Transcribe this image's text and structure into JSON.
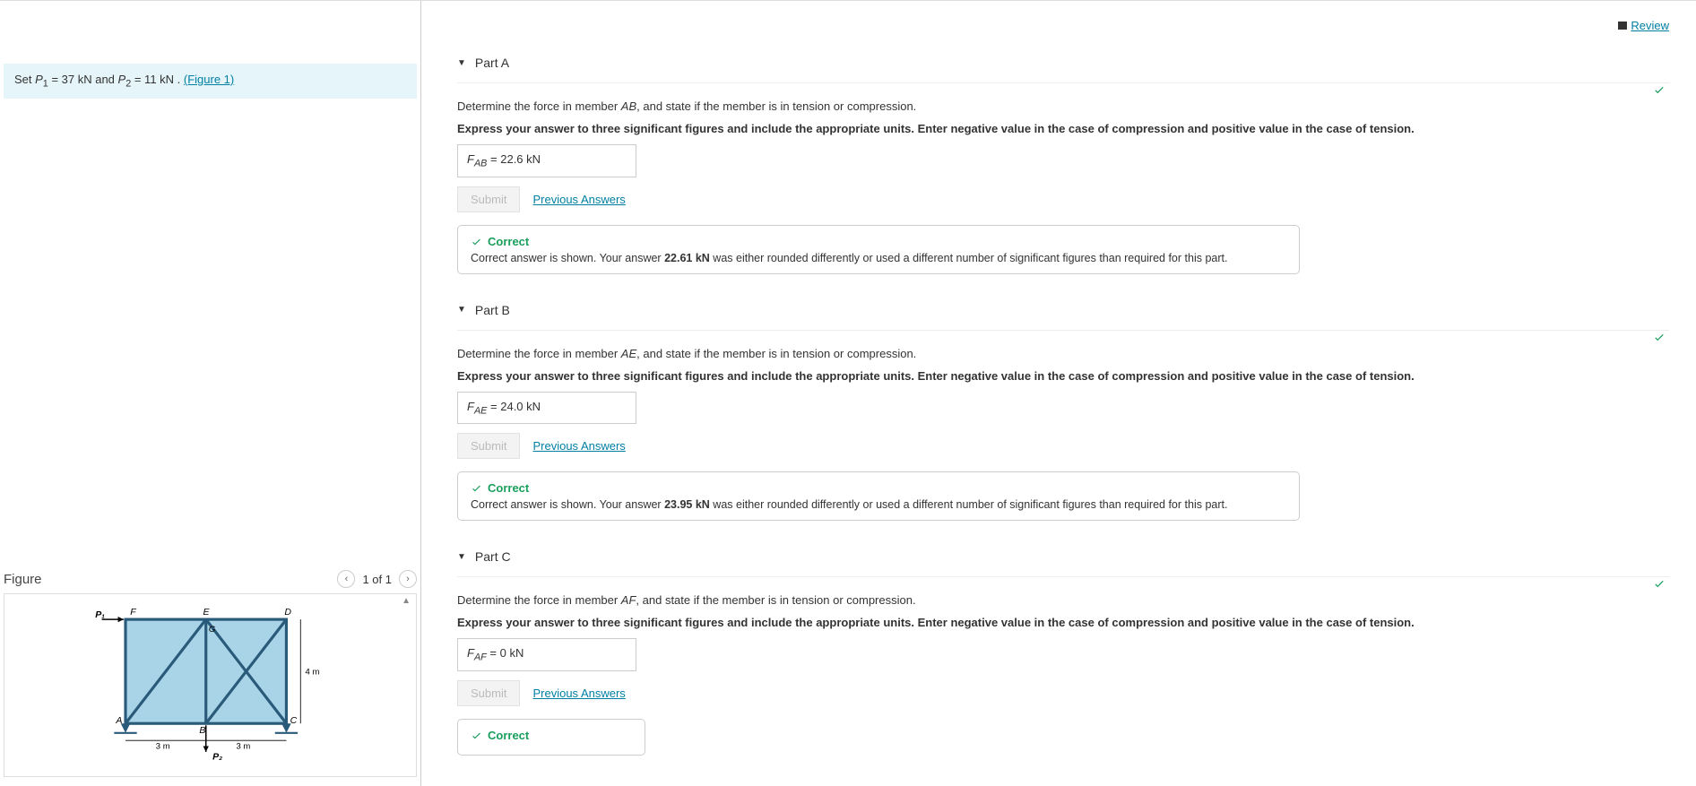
{
  "topbar": {
    "review_label": "Review"
  },
  "problem": {
    "set_prefix": "Set ",
    "p1_label": "P",
    "p1_sub": "1",
    "p1_value": " = 37  kN and ",
    "p2_label": "P",
    "p2_sub": "2",
    "p2_value": " = 11  kN . ",
    "figure_link": "(Figure 1)"
  },
  "figure": {
    "title": "Figure",
    "counter": "1 of 1",
    "labels": {
      "P1": "P₁",
      "F": "F",
      "E": "E",
      "D": "D",
      "G": "G",
      "A": "A",
      "B": "B",
      "C": "C",
      "P2": "P₂",
      "dim_3m_a": "3 m",
      "dim_3m_b": "3 m",
      "dim_4m": "4 m"
    }
  },
  "parts": {
    "A": {
      "title": "Part A",
      "prompt_pre": "Determine the force in member ",
      "member": "AB",
      "prompt_post": ", and state if the member is in tension or compression.",
      "instructions": "Express your answer to three significant figures and include the appropriate units. Enter negative value in the case of compression and positive value in the case of tension.",
      "force_label": "F",
      "force_sub": "AB",
      "equals": " = ",
      "answer": "22.6 kN",
      "submit_label": "Submit",
      "prev_label": "Previous Answers",
      "fb_title": "Correct",
      "fb_body_pre": "Correct answer is shown. Your answer ",
      "fb_user_answer": "22.61 kN",
      "fb_body_post": " was either rounded differently or used a different number of significant figures than required for this part."
    },
    "B": {
      "title": "Part B",
      "prompt_pre": "Determine the force in member ",
      "member": "AE",
      "prompt_post": ", and state if the member is in tension or compression.",
      "instructions": "Express your answer to three significant figures and include the appropriate units. Enter negative value in the case of compression and positive value in the case of tension.",
      "force_label": "F",
      "force_sub": "AE",
      "equals": " = ",
      "answer": "24.0 kN",
      "submit_label": "Submit",
      "prev_label": "Previous Answers",
      "fb_title": "Correct",
      "fb_body_pre": "Correct answer is shown. Your answer ",
      "fb_user_answer": "23.95 kN",
      "fb_body_post": " was either rounded differently or used a different number of significant figures than required for this part."
    },
    "C": {
      "title": "Part C",
      "prompt_pre": "Determine the force in member ",
      "member": "AF",
      "prompt_post": ", and state if the member is in tension or compression.",
      "instructions": "Express your answer to three significant figures and include the appropriate units. Enter negative value in the case of compression and positive value in the case of tension.",
      "force_label": "F",
      "force_sub": "AF",
      "equals": " = ",
      "answer": "0 kN",
      "submit_label": "Submit",
      "prev_label": "Previous Answers",
      "fb_title": "Correct"
    }
  }
}
